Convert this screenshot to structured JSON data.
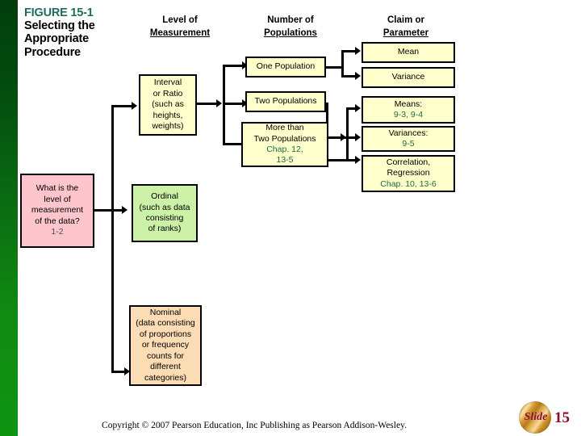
{
  "figure": {
    "id": "FIGURE 15-1",
    "title_line1": "Selecting the",
    "title_line2": "Appropriate",
    "title_line3": "Procedure"
  },
  "columns": [
    {
      "name": "level-of-measurement",
      "line1": "Level of",
      "line2": "Measurement"
    },
    {
      "name": "number-of-populations",
      "line1": "Number of",
      "line2": "Populations"
    },
    {
      "name": "claim-or-parameter",
      "line1": "Claim or",
      "line2": "Parameter"
    }
  ],
  "start_box": {
    "line1": "What is the",
    "line2": "level of",
    "line3": "measurement",
    "line4": "of the data?",
    "ref": "1-2"
  },
  "level_boxes": [
    {
      "key": "interval",
      "line1": "Interval",
      "line2": "or Ratio",
      "line3": "(such as",
      "line4": "heights,",
      "line5": "weights)"
    },
    {
      "key": "ordinal",
      "line1": "Ordinal",
      "line2": "(such as data",
      "line3": "consisting",
      "line4": "of  ranks)"
    },
    {
      "key": "nominal",
      "line1": "Nominal",
      "line2": "(data consisting",
      "line3": "of proportions",
      "line4": "or frequency",
      "line5": "counts for",
      "line6": "different",
      "line7": "categories)"
    }
  ],
  "population_boxes": [
    {
      "key": "one-population",
      "line1": "One Population"
    },
    {
      "key": "two-populations",
      "line1": "Two Populations"
    },
    {
      "key": "more-than-two-populations",
      "line1": "More than",
      "line2": "Two Populations",
      "chap1": "Chap. 12,",
      "chap2": "13-5"
    }
  ],
  "parameter_boxes": [
    {
      "key": "mean",
      "line1": "Mean"
    },
    {
      "key": "variance",
      "line1": "Variance"
    },
    {
      "key": "means",
      "line1": "Means:",
      "chap1": "9-3, 9-4"
    },
    {
      "key": "variances",
      "line1": "Variances:",
      "chap1": "9-5"
    },
    {
      "key": "correlation-regression",
      "line1": "Correlation,",
      "line2": "Regression",
      "chap1": "Chap. 10,  13-6"
    }
  ],
  "footer": {
    "copyright": "Copyright © 2007 Pearson Education, Inc Publishing as Pearson Addison-Wesley.",
    "slide_word": "Slide",
    "slide_number": "15"
  },
  "colors": {
    "accent_teal": "#1f6b5e",
    "chapter_green": "#1f6b3f",
    "box_yellow": "#ffffcc",
    "box_pink": "#ffc5cd",
    "box_light_green": "#ccf2a8",
    "box_peach": "#fcdcb4",
    "sidebar_green": "#0a6a12",
    "badge_red": "#8c0b2a"
  }
}
